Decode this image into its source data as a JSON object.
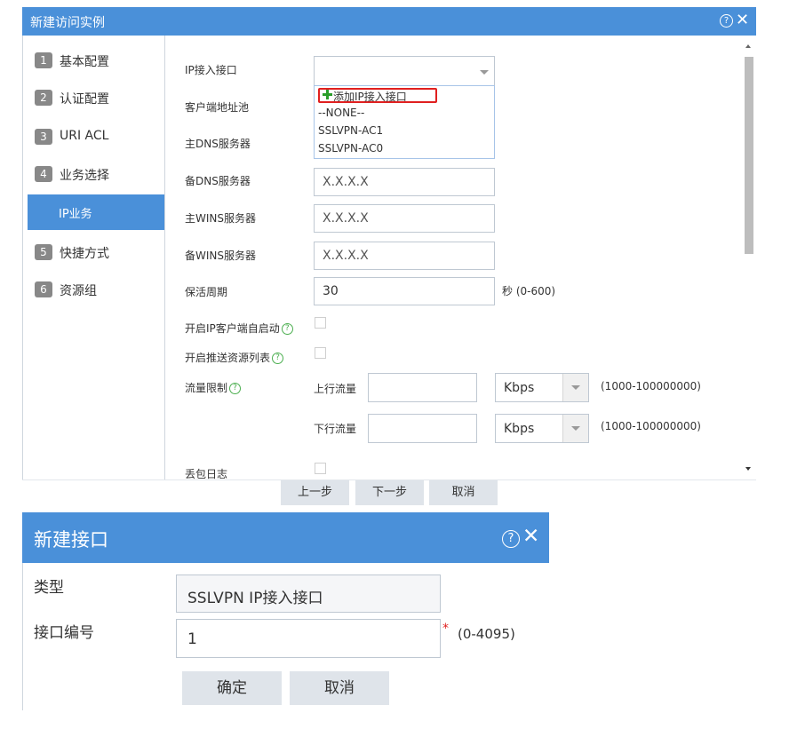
{
  "dialog1": {
    "title": "新建访问实例",
    "nav": [
      {
        "num": "1",
        "label": "基本配置"
      },
      {
        "num": "2",
        "label": "认证配置"
      },
      {
        "num": "3",
        "label": "URI ACL"
      },
      {
        "num": "4",
        "label": "业务选择"
      },
      {
        "num": "5",
        "label": "快捷方式"
      },
      {
        "num": "6",
        "label": "资源组"
      }
    ],
    "nav_sub": "IP业务",
    "form": {
      "ip_if_label": "IP接入接口",
      "client_pool_label": "客户端地址池",
      "dns1_label": "主DNS服务器",
      "dns1_placeholder": "X.X.X.X",
      "dns2_label": "备DNS服务器",
      "dns2_placeholder": "X.X.X.X",
      "wins1_label": "主WINS服务器",
      "wins1_placeholder": "X.X.X.X",
      "wins2_label": "备WINS服务器",
      "wins2_placeholder": "X.X.X.X",
      "keepalive_label": "保活周期",
      "keepalive_value": "30",
      "keepalive_hint": "秒 (0-600)",
      "autostart_label": "开启IP客户端自启动",
      "push_label": "开启推送资源列表",
      "rate_label": "流量限制",
      "up_label": "上行流量",
      "down_label": "下行流量",
      "up_unit": "Kbps",
      "down_unit": "Kbps",
      "up_hint": "(1000-100000000)",
      "down_hint": "(1000-100000000)",
      "droplog_label": "丢包日志"
    },
    "dropdown": {
      "add": "添加IP接入接口",
      "options": [
        "--NONE--",
        "SSLVPN-AC1",
        "SSLVPN-AC0"
      ]
    },
    "buttons": {
      "prev": "上一步",
      "next": "下一步",
      "cancel": "取消"
    }
  },
  "dialog2": {
    "title": "新建接口",
    "type_label": "类型",
    "type_value": "SSLVPN IP接入接口",
    "ifnum_label": "接口编号",
    "ifnum_value": "1",
    "required_mark": "*",
    "ifnum_hint": "(0-4095)",
    "buttons": {
      "ok": "确定",
      "cancel": "取消"
    }
  },
  "colors": {
    "accent": "#4a90d9",
    "highlight": "#e02020",
    "required": "#e02020"
  }
}
